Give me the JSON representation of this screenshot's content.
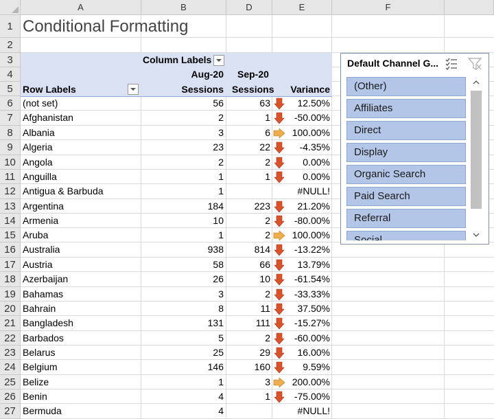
{
  "columns": [
    "A",
    "B",
    "D",
    "E",
    "F"
  ],
  "rows": [
    "1",
    "2",
    "3",
    "4",
    "5",
    "6",
    "7",
    "8",
    "9",
    "10",
    "11",
    "12",
    "13",
    "14",
    "15",
    "16",
    "17",
    "18",
    "19",
    "20",
    "21",
    "22",
    "23",
    "24",
    "25",
    "26",
    "27"
  ],
  "title": "Conditional Formatting",
  "pivot": {
    "column_labels": "Column Labels",
    "aug_label": "Aug-20",
    "sep_label": "Sep-20",
    "row_labels": "Row Labels",
    "sessions_b": "Sessions",
    "sessions_d": "Sessions",
    "variance": "Variance",
    "data": [
      {
        "country": "(not set)",
        "aug": "56",
        "sep": "63",
        "arrow": "down",
        "variance": "12.50%"
      },
      {
        "country": "Afghanistan",
        "aug": "2",
        "sep": "1",
        "arrow": "down",
        "variance": "-50.00%"
      },
      {
        "country": "Albania",
        "aug": "3",
        "sep": "6",
        "arrow": "right",
        "variance": "100.00%"
      },
      {
        "country": "Algeria",
        "aug": "23",
        "sep": "22",
        "arrow": "down",
        "variance": "-4.35%"
      },
      {
        "country": "Angola",
        "aug": "2",
        "sep": "2",
        "arrow": "down",
        "variance": "0.00%"
      },
      {
        "country": "Anguilla",
        "aug": "1",
        "sep": "1",
        "arrow": "down",
        "variance": "0.00%"
      },
      {
        "country": "Antigua & Barbuda",
        "aug": "1",
        "sep": "",
        "arrow": "",
        "variance": "#NULL!"
      },
      {
        "country": "Argentina",
        "aug": "184",
        "sep": "223",
        "arrow": "down",
        "variance": "21.20%"
      },
      {
        "country": "Armenia",
        "aug": "10",
        "sep": "2",
        "arrow": "down",
        "variance": "-80.00%"
      },
      {
        "country": "Aruba",
        "aug": "1",
        "sep": "2",
        "arrow": "right",
        "variance": "100.00%"
      },
      {
        "country": "Australia",
        "aug": "938",
        "sep": "814",
        "arrow": "down",
        "variance": "-13.22%"
      },
      {
        "country": "Austria",
        "aug": "58",
        "sep": "66",
        "arrow": "down",
        "variance": "13.79%"
      },
      {
        "country": "Azerbaijan",
        "aug": "26",
        "sep": "10",
        "arrow": "down",
        "variance": "-61.54%"
      },
      {
        "country": "Bahamas",
        "aug": "3",
        "sep": "2",
        "arrow": "down",
        "variance": "-33.33%"
      },
      {
        "country": "Bahrain",
        "aug": "8",
        "sep": "11",
        "arrow": "down",
        "variance": "37.50%"
      },
      {
        "country": "Bangladesh",
        "aug": "131",
        "sep": "111",
        "arrow": "down",
        "variance": "-15.27%"
      },
      {
        "country": "Barbados",
        "aug": "5",
        "sep": "2",
        "arrow": "down",
        "variance": "-60.00%"
      },
      {
        "country": "Belarus",
        "aug": "25",
        "sep": "29",
        "arrow": "down",
        "variance": "16.00%"
      },
      {
        "country": "Belgium",
        "aug": "146",
        "sep": "160",
        "arrow": "down",
        "variance": "9.59%"
      },
      {
        "country": "Belize",
        "aug": "1",
        "sep": "3",
        "arrow": "right",
        "variance": "200.00%"
      },
      {
        "country": "Benin",
        "aug": "4",
        "sep": "1",
        "arrow": "down",
        "variance": "-75.00%"
      },
      {
        "country": "Bermuda",
        "aug": "4",
        "sep": "",
        "arrow": "",
        "variance": "#NULL!"
      }
    ]
  },
  "slicer": {
    "title": "Default Channel G...",
    "items": [
      "(Other)",
      "Affiliates",
      "Direct",
      "Display",
      "Organic Search",
      "Paid Search",
      "Referral",
      "Social"
    ],
    "multiselect_icon": "multi-select-icon",
    "clear_filter_icon": "clear-filter-icon"
  },
  "colors": {
    "pivot_header": "#d9e1f2",
    "slicer_item": "#b4c6e7",
    "arrow_down": "#d9532a",
    "arrow_right": "#f0ad4e"
  }
}
